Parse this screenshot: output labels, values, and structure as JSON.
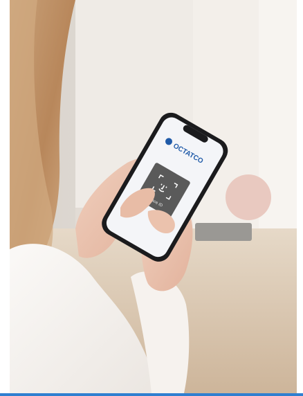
{
  "photo": {
    "description_icon": "phone-face-id-photo",
    "brand_logo": "OCTATCO",
    "face_id_label": "Face ID"
  },
  "colors": {
    "accent_rule": "#2f7fd0",
    "logo_blue": "#1f5aa8",
    "faceid_tile": "#5a5a5a",
    "screen": "#f4f5f8"
  }
}
